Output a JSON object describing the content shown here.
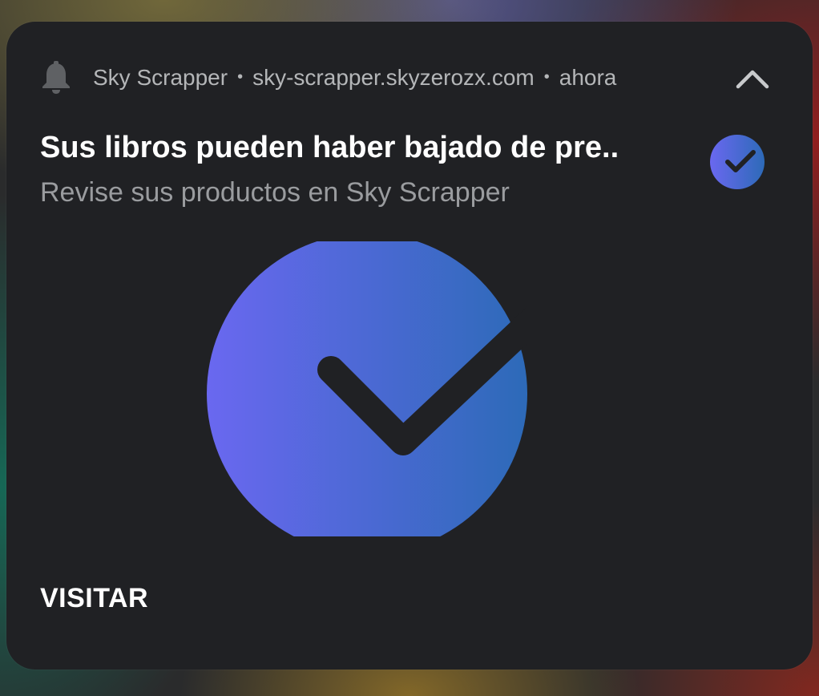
{
  "notification": {
    "app_name": "Sky Scrapper",
    "separator": "•",
    "domain": "sky-scrapper.skyzerozx.com",
    "time": "ahora",
    "title": "Sus libros pueden haber bajado de pre..",
    "body": "Revise sus productos en Sky Scrapper",
    "action_label": "VISITAR"
  },
  "icons": {
    "bell": "bell-icon",
    "collapse": "chevron-up-icon",
    "app_icon": "checkmark-circle-icon"
  },
  "colors": {
    "card_background": "#202124",
    "title_text": "#ffffff",
    "secondary_text": "#9a9c9f",
    "brand_gradient_start": "#6a68f0",
    "brand_gradient_end": "#2d6ab8",
    "check_stroke": "#202124"
  }
}
